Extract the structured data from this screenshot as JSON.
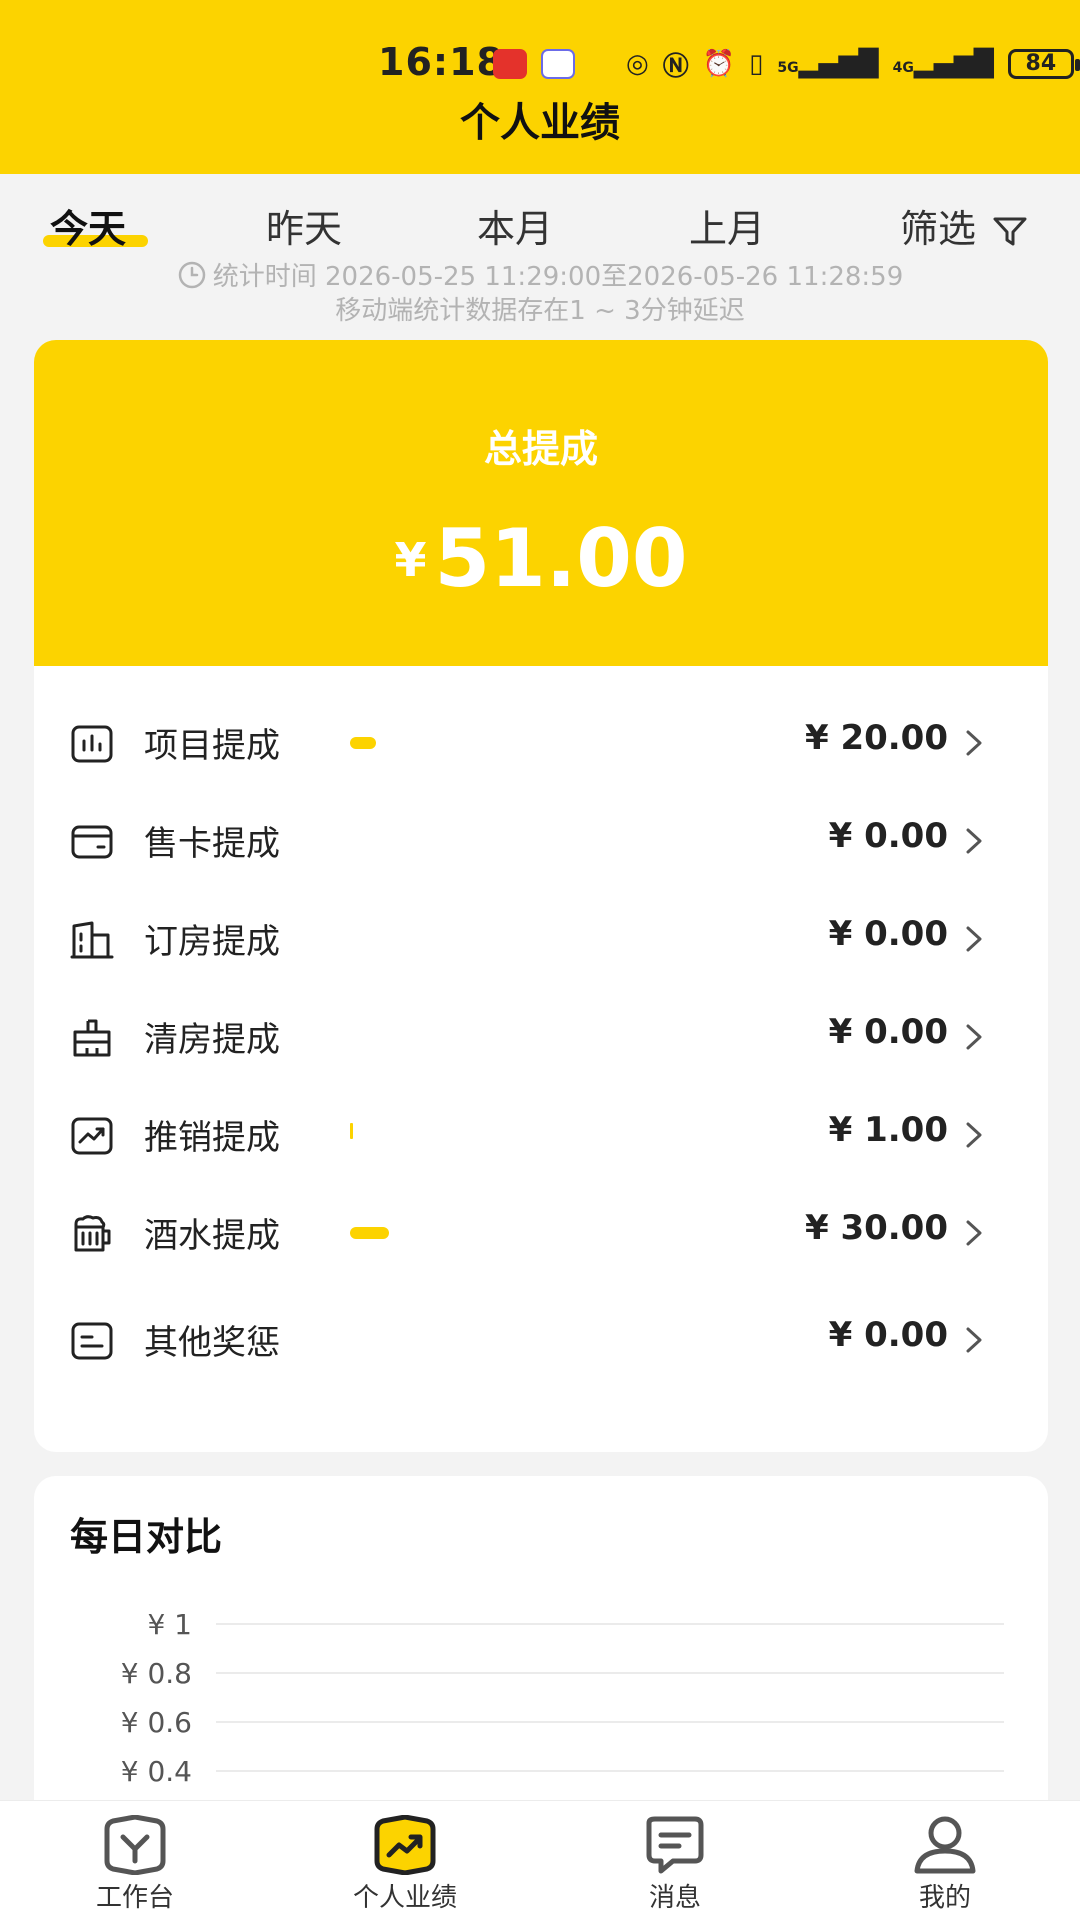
{
  "status_bar": {
    "time": "16:18",
    "battery": "84",
    "net1": "5G",
    "net2": "4G"
  },
  "header": {
    "title": "个人业绩"
  },
  "tabs": [
    {
      "label": "今天",
      "active": true
    },
    {
      "label": "昨天",
      "active": false
    },
    {
      "label": "本月",
      "active": false
    },
    {
      "label": "上月",
      "active": false
    }
  ],
  "filter": {
    "label": "筛选"
  },
  "stats": {
    "time_range": "统计时间 2026-05-25 11:29:00至2026-05-26 11:28:59",
    "delay_note": "移动端统计数据存在1 ~ 3分钟延迟"
  },
  "total": {
    "label": "总提成",
    "currency": "¥",
    "value": "51.00"
  },
  "rows": [
    {
      "label": "项目提成",
      "amount": "¥ 20.00",
      "icon": "bar-chart-icon",
      "bar_fraction": 0.39
    },
    {
      "label": "售卡提成",
      "amount": "¥ 0.00",
      "icon": "wallet-icon",
      "bar_fraction": 0
    },
    {
      "label": "订房提成",
      "amount": "¥ 0.00",
      "icon": "building-icon",
      "bar_fraction": 0
    },
    {
      "label": "清房提成",
      "amount": "¥ 0.00",
      "icon": "broom-icon",
      "bar_fraction": 0
    },
    {
      "label": "推销提成",
      "amount": "¥ 1.00",
      "icon": "trend-icon",
      "bar_fraction": 0.02
    },
    {
      "label": "酒水提成",
      "amount": "¥ 30.00",
      "icon": "beer-icon",
      "bar_fraction": 0.59
    },
    {
      "label": "其他奖惩",
      "amount": "¥ 0.00",
      "icon": "note-icon",
      "bar_fraction": 0
    }
  ],
  "chart_section": {
    "title": "每日对比"
  },
  "chart_data": {
    "type": "line",
    "title": "每日对比",
    "y_tick_labels": [
      "¥ 1",
      "¥ 0.8",
      "¥ 0.6",
      "¥ 0.4"
    ],
    "y_ticks": [
      1,
      0.8,
      0.6,
      0.4
    ],
    "ylim": [
      0,
      1
    ],
    "grid": true
  },
  "nav": [
    {
      "label": "工作台",
      "icon": "workbench-icon",
      "active": false
    },
    {
      "label": "个人业绩",
      "icon": "performance-icon",
      "active": true
    },
    {
      "label": "消息",
      "icon": "message-icon",
      "active": false
    },
    {
      "label": "我的",
      "icon": "user-icon",
      "active": false
    }
  ],
  "colors": {
    "brand": "#FCD300",
    "text": "#222222",
    "muted": "#B3B3B3",
    "background": "#F3F3F3"
  }
}
